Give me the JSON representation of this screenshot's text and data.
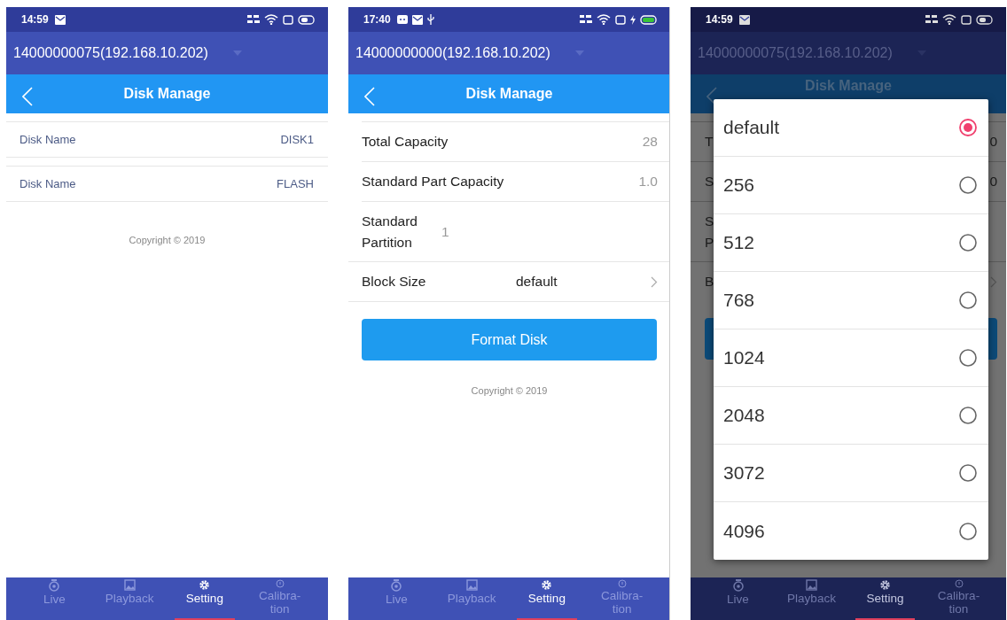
{
  "phones": [
    {
      "dimmed": false,
      "status_bar": {
        "kind": "plain",
        "time": "14:59"
      },
      "device": "14000000075(192.168.10.202)",
      "title": "Disk Manage",
      "body": {
        "kind": "disk_list",
        "rows": [
          {
            "label": "Disk Name",
            "value": "DISK1"
          },
          {
            "label": "Disk Name",
            "value": "FLASH"
          }
        ],
        "copyright": "Copyright © 2019"
      },
      "nav": [
        {
          "label": "Live",
          "selected": false
        },
        {
          "label": "Playback",
          "selected": false
        },
        {
          "label": "Setting",
          "selected": true
        },
        {
          "label": "Calibra-tion",
          "selected": false
        }
      ]
    },
    {
      "dimmed": false,
      "status_bar": {
        "kind": "charging",
        "time": "17:40"
      },
      "device": "14000000000(192.168.10.202)",
      "title": "Disk Manage",
      "body": {
        "kind": "disk_info",
        "rows": [
          {
            "kind": "value",
            "label": "Total Capacity",
            "value": "28"
          },
          {
            "kind": "value",
            "label": "Standard Part Capacity",
            "value": "1.0"
          },
          {
            "kind": "inline",
            "label": "Standard Partition",
            "value": "1"
          },
          {
            "kind": "select",
            "label": "Block Size",
            "value": "default"
          }
        ],
        "button": "Format Disk",
        "copyright": "Copyright © 2019"
      },
      "nav": [
        {
          "label": "Live",
          "selected": false
        },
        {
          "label": "Playback",
          "selected": false
        },
        {
          "label": "Setting",
          "selected": true
        },
        {
          "label": "Calibra-tion",
          "selected": false
        }
      ]
    },
    {
      "dimmed": true,
      "status_bar": {
        "kind": "plain",
        "time": "14:59"
      },
      "device": "14000000075(192.168.10.202)",
      "title": "Disk Manage",
      "body": {
        "kind": "covered",
        "rows": [
          {
            "label": "T",
            "value": "0"
          },
          {
            "label": "S",
            "value": "0"
          },
          {
            "label": "S",
            "label_2": "P"
          },
          {
            "label": "B",
            "chevron": true
          }
        ],
        "dialog": {
          "options": [
            {
              "label": "default",
              "selected": true
            },
            {
              "label": "256",
              "selected": false
            },
            {
              "label": "512",
              "selected": false
            },
            {
              "label": "768",
              "selected": false
            },
            {
              "label": "1024",
              "selected": false
            },
            {
              "label": "2048",
              "selected": false
            },
            {
              "label": "3072",
              "selected": false
            },
            {
              "label": "4096",
              "selected": false
            }
          ]
        }
      },
      "nav": [
        {
          "label": "Live",
          "selected": false
        },
        {
          "label": "Playback",
          "selected": false
        },
        {
          "label": "Setting",
          "selected": true
        },
        {
          "label": "Calibra-tion",
          "selected": false
        }
      ]
    }
  ]
}
